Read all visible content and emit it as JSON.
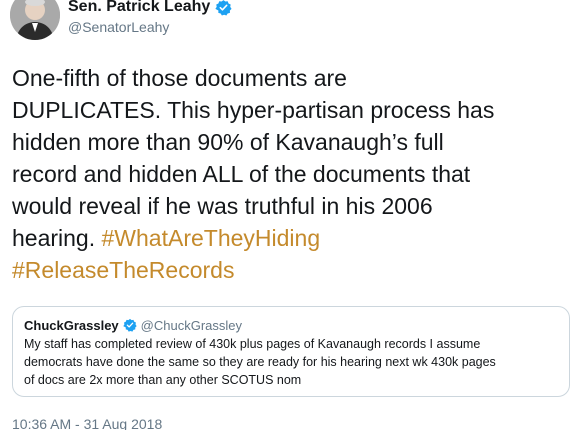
{
  "tweet": {
    "author": {
      "display_name": "Sen. Patrick Leahy",
      "handle": "@SenatorLeahy",
      "verified_icon": "verified-badge-icon",
      "avatar_icon": "profile-photo"
    },
    "text_lines": [
      "One-fifth of those documents are",
      "DUPLICATES. This hyper-partisan process has",
      "hidden more than 90% of Kavanaugh’s full",
      "record and hidden ALL of the documents that",
      "would reveal if he was truthful in his 2006",
      "hearing."
    ],
    "hashtags": [
      "#WhatAreTheyHiding",
      "#ReleaseTheRecords"
    ],
    "timestamp": "10:36 AM - 31 Aug 2018"
  },
  "quoted_tweet": {
    "display_name": "ChuckGrassley",
    "handle": "@ChuckGrassley",
    "verified_icon": "verified-badge-icon",
    "text_lines": [
      "My staff has completed review of 430k plus pages of Kavanaugh records I assume",
      "democrats have done the same so they are ready for his hearing next wk 430k pages",
      "of docs are 2x more than any other SCOTUS nom"
    ]
  },
  "colors": {
    "text": "#14171a",
    "secondary": "#657786",
    "hashtag": "#c48a2c",
    "verified": "#1da1f2",
    "border": "#ccd6dd"
  }
}
